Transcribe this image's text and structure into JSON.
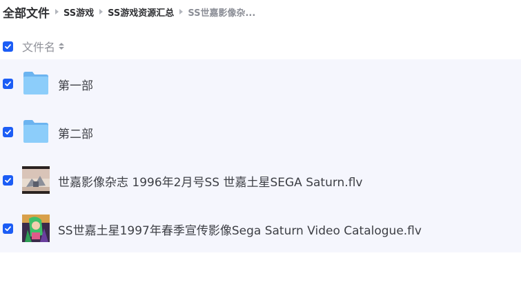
{
  "breadcrumb": {
    "root": "全部文件",
    "items": [
      "SS游戏",
      "SS游戏资源汇总",
      "SS世嘉影像杂..."
    ]
  },
  "header": {
    "column_label": "文件名"
  },
  "files": [
    {
      "name": "第一部",
      "type": "folder",
      "checked": true
    },
    {
      "name": "第二部",
      "type": "folder",
      "checked": true
    },
    {
      "name": "世嘉影像杂志 1996年2月号SS 世嘉土星SEGA Saturn.flv",
      "type": "video",
      "checked": true
    },
    {
      "name": "SS世嘉土星1997年春季宣传影像Sega Saturn Video Catalogue.flv",
      "type": "video",
      "checked": true
    }
  ],
  "colors": {
    "accent": "#1c5df5",
    "list_background": "#f5f6fd",
    "folder": "#7cc1f7"
  }
}
